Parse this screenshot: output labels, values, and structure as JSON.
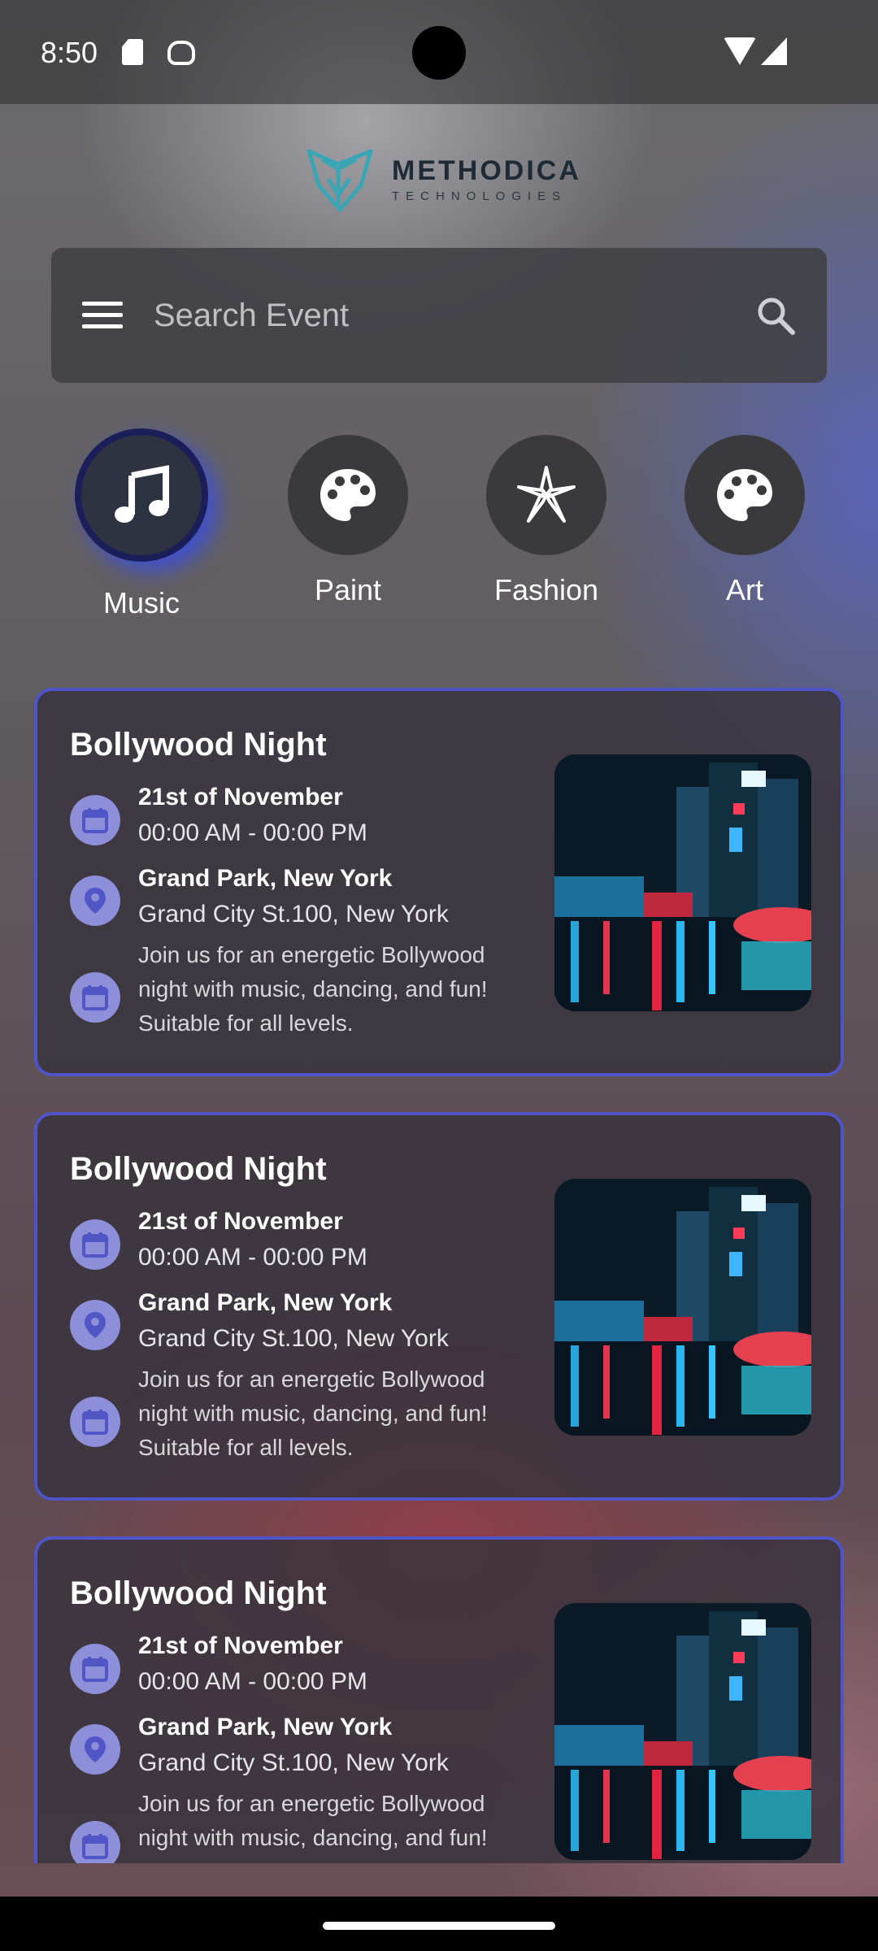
{
  "status_bar": {
    "time": "8:50"
  },
  "logo": {
    "title": "METHODICA",
    "subtitle": "TECHNOLOGIES"
  },
  "search": {
    "placeholder": "Search Event"
  },
  "categories": [
    {
      "label": "Music",
      "icon": "music-note-icon",
      "active": true
    },
    {
      "label": "Paint",
      "icon": "palette-icon",
      "active": false
    },
    {
      "label": "Fashion",
      "icon": "fashion-icon",
      "active": false
    },
    {
      "label": "Art",
      "icon": "palette-icon",
      "active": false
    }
  ],
  "events": [
    {
      "title": "Bollywood Night",
      "date": "21st of November",
      "time": "00:00 AM - 00:00 PM",
      "venue": "Grand Park, New York",
      "address": "Grand City St.100, New York",
      "description": "Join us for an energetic Bollywood night with music, dancing, and fun! Suitable for all levels."
    },
    {
      "title": "Bollywood Night",
      "date": "21st of November",
      "time": "00:00 AM - 00:00 PM",
      "venue": "Grand Park, New York",
      "address": "Grand City St.100, New York",
      "description": "Join us for an energetic Bollywood night with music, dancing, and fun! Suitable for all levels."
    },
    {
      "title": "Bollywood Night",
      "date": "21st of November",
      "time": "00:00 AM - 00:00 PM",
      "venue": "Grand Park, New York",
      "address": "Grand City St.100, New York",
      "description": "Join us for an energetic Bollywood night with music, dancing, and fun! Suitable for all levels."
    }
  ],
  "colors": {
    "accent": "#4f55c8",
    "icon_bg": "#8d8fd8",
    "icon_fg": "#5156c7"
  }
}
